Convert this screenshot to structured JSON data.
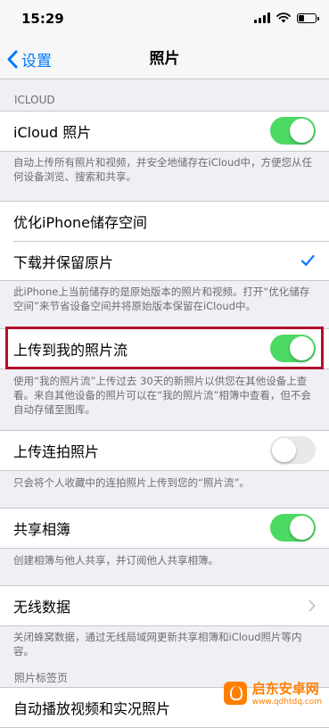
{
  "status_bar": {
    "time": "15:29"
  },
  "nav": {
    "back_label": "设置",
    "title": "照片"
  },
  "icloud_section": {
    "header": "ICLOUD",
    "icloud_photos": {
      "label": "iCloud 照片",
      "enabled": true
    },
    "icloud_photos_footer": "自动上传所有照片和视频，并安全地储存在iCloud中，方便您从任何设备浏览、搜索和共享。"
  },
  "storage": {
    "optimize_label": "优化iPhone储存空间",
    "download_label": "下载并保留原片",
    "selected": "download",
    "footer": "此iPhone上当前储存的是原始版本的照片和视频。打开“优化储存空间”来节省设备空间并将原始版本保留在iCloud中。"
  },
  "photo_stream": {
    "label": "上传到我的照片流",
    "enabled": true,
    "footer": "使用“我的照片流”上传过去 30天的新照片以供您在其他设备上查看。来自其他设备的照片可以在“我的照片流”相簿中查看，但不会自动存储至图库。"
  },
  "burst": {
    "label": "上传连拍照片",
    "enabled": false,
    "footer": "只会将个人收藏中的连拍照片上传到您的“照片流”。"
  },
  "shared_albums": {
    "label": "共享相簿",
    "enabled": true,
    "footer": "创建相簿与他人共享，并订阅他人共享相簿。"
  },
  "wireless_data": {
    "label": "无线数据",
    "footer": "关闭蜂窝数据，通过无线局域网更新共享相簿和iCloud照片等内容。"
  },
  "photos_tab": {
    "header": "照片标签页",
    "autoplay_label": "自动播放视频和实况照片"
  },
  "watermark": {
    "name": "启东安卓网",
    "url": "www.qdhtdq.com"
  },
  "colors": {
    "accent": "#007aff",
    "toggle_on": "#4cd964",
    "highlight": "#b0102a"
  }
}
